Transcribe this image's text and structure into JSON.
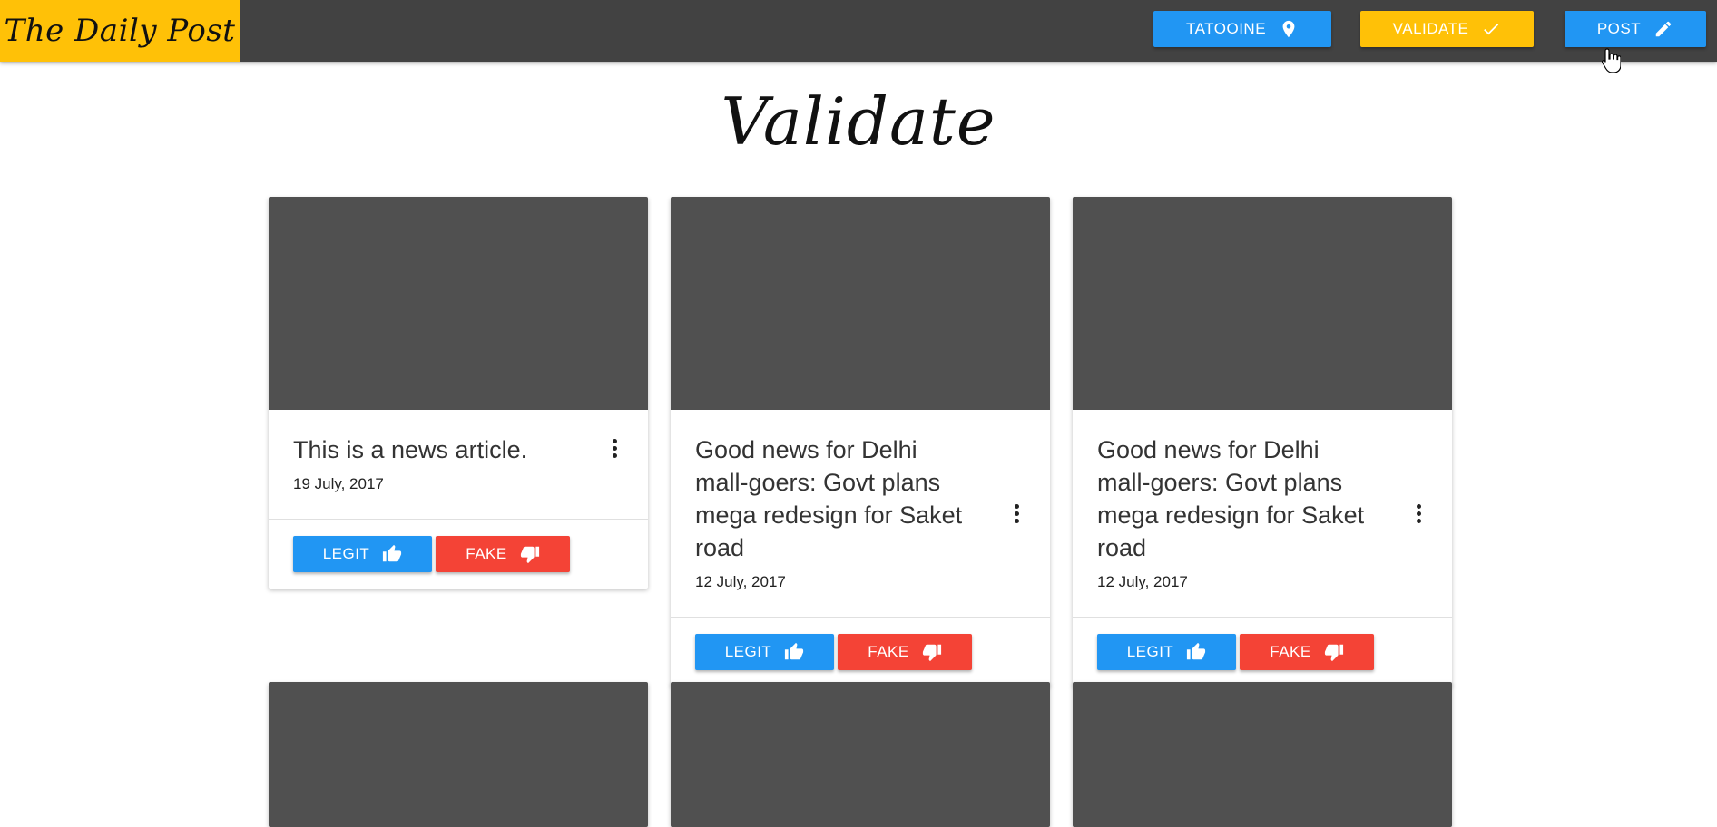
{
  "header": {
    "brand": "The Daily Post",
    "nav": [
      {
        "label": "TATOOINE",
        "icon": "map-pin-icon"
      },
      {
        "label": "VALIDATE",
        "icon": "check-icon"
      },
      {
        "label": "POST",
        "icon": "pencil-icon"
      }
    ]
  },
  "page": {
    "title": "Validate"
  },
  "cards": [
    {
      "title": "This is a news article.",
      "date": "19 July, 2017",
      "legit_label": "LEGIT",
      "fake_label": "FAKE"
    },
    {
      "title": "Good news for Delhi mall-goers: Govt plans mega redesign for Saket road",
      "date": "12 July, 2017",
      "legit_label": "LEGIT",
      "fake_label": "FAKE"
    },
    {
      "title": "Good news for Delhi mall-goers: Govt plans mega redesign for Saket road",
      "date": "12 July, 2017",
      "legit_label": "LEGIT",
      "fake_label": "FAKE"
    }
  ],
  "colors": {
    "topbar": "#424242",
    "brand": "#ffc107",
    "primary": "#2196f3",
    "accent": "#ffc107",
    "danger": "#f44336",
    "image_placeholder": "#505050"
  }
}
